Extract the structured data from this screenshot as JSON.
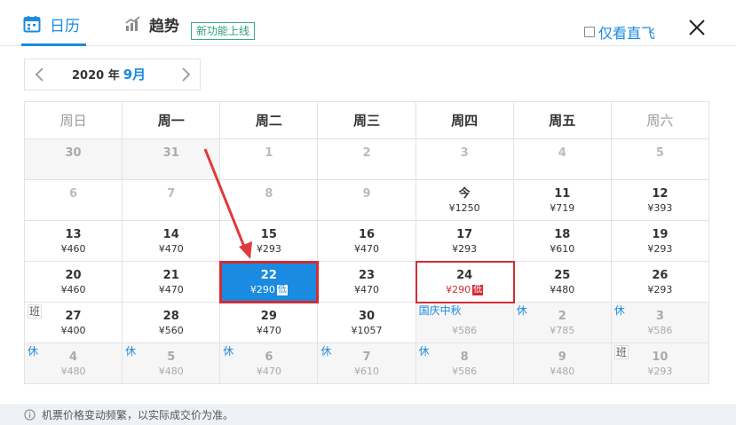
{
  "tabs": {
    "calendar": {
      "label": "日历",
      "icon": "calendar-icon"
    },
    "trend": {
      "label": "趋势",
      "icon": "bar-chart-icon",
      "badge": "新功能上线"
    }
  },
  "direct_only": {
    "label": "仅看直飞",
    "checked": false
  },
  "month_nav": {
    "year_text": "2020 年",
    "month_text": "9月"
  },
  "weekdays": [
    "周日",
    "周一",
    "周二",
    "周三",
    "周四",
    "周五",
    "周六"
  ],
  "weeks": [
    [
      {
        "num": "30",
        "price": "",
        "state": "inactive"
      },
      {
        "num": "31",
        "price": "",
        "state": "inactive"
      },
      {
        "num": "1",
        "price": "",
        "state": "grey"
      },
      {
        "num": "2",
        "price": "",
        "state": "grey"
      },
      {
        "num": "3",
        "price": "",
        "state": "grey"
      },
      {
        "num": "4",
        "price": "",
        "state": "grey"
      },
      {
        "num": "5",
        "price": "",
        "state": "grey"
      }
    ],
    [
      {
        "num": "6",
        "price": "",
        "state": "grey"
      },
      {
        "num": "7",
        "price": "",
        "state": "grey"
      },
      {
        "num": "8",
        "price": "",
        "state": "grey"
      },
      {
        "num": "9",
        "price": "",
        "state": "grey"
      },
      {
        "num": "今",
        "price": "¥1250",
        "state": "active"
      },
      {
        "num": "11",
        "price": "¥719",
        "state": "active"
      },
      {
        "num": "12",
        "price": "¥393",
        "state": "active"
      }
    ],
    [
      {
        "num": "13",
        "price": "¥460",
        "state": "active"
      },
      {
        "num": "14",
        "price": "¥470",
        "state": "active"
      },
      {
        "num": "15",
        "price": "¥293",
        "state": "active"
      },
      {
        "num": "16",
        "price": "¥470",
        "state": "active"
      },
      {
        "num": "17",
        "price": "¥293",
        "state": "active"
      },
      {
        "num": "18",
        "price": "¥610",
        "state": "active"
      },
      {
        "num": "19",
        "price": "¥293",
        "state": "active"
      }
    ],
    [
      {
        "num": "20",
        "price": "¥460",
        "state": "active"
      },
      {
        "num": "21",
        "price": "¥470",
        "state": "active"
      },
      {
        "num": "22",
        "price": "¥290",
        "state": "selected",
        "low": "低"
      },
      {
        "num": "23",
        "price": "¥470",
        "state": "active"
      },
      {
        "num": "24",
        "price": "¥290",
        "state": "highlight",
        "low": "低"
      },
      {
        "num": "25",
        "price": "¥480",
        "state": "active"
      },
      {
        "num": "26",
        "price": "¥293",
        "state": "active"
      }
    ],
    [
      {
        "num": "27",
        "price": "¥400",
        "state": "active",
        "tag": "班",
        "tag_style": "grey"
      },
      {
        "num": "28",
        "price": "¥560",
        "state": "active"
      },
      {
        "num": "29",
        "price": "¥470",
        "state": "active"
      },
      {
        "num": "30",
        "price": "¥1057",
        "state": "active"
      },
      {
        "num": "",
        "price": "¥586",
        "state": "inactive",
        "tag": "国庆中秋",
        "tag_style": "blue"
      },
      {
        "num": "2",
        "price": "¥785",
        "state": "inactive",
        "tag": "休",
        "tag_style": "blue"
      },
      {
        "num": "3",
        "price": "¥586",
        "state": "inactive",
        "tag": "休",
        "tag_style": "blue"
      }
    ],
    [
      {
        "num": "4",
        "price": "¥480",
        "state": "inactive",
        "tag": "休",
        "tag_style": "blue"
      },
      {
        "num": "5",
        "price": "¥480",
        "state": "inactive",
        "tag": "休",
        "tag_style": "blue"
      },
      {
        "num": "6",
        "price": "¥470",
        "state": "inactive",
        "tag": "休",
        "tag_style": "blue"
      },
      {
        "num": "7",
        "price": "¥610",
        "state": "inactive",
        "tag": "休",
        "tag_style": "blue"
      },
      {
        "num": "8",
        "price": "¥586",
        "state": "inactive",
        "tag": "休",
        "tag_style": "blue"
      },
      {
        "num": "9",
        "price": "¥480",
        "state": "inactive"
      },
      {
        "num": "10",
        "price": "¥293",
        "state": "inactive",
        "tag": "班",
        "tag_style": "grey"
      }
    ]
  ],
  "footer": {
    "text": "机票价格变动频繁，以实际成交价为准。"
  },
  "colors": {
    "accent": "#1a8be0",
    "alert": "#d22c34",
    "badge_green": "#2f9c7c"
  }
}
